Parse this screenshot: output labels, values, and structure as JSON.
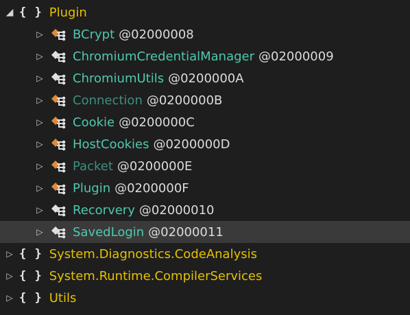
{
  "colors": {
    "background": "#1e1e1e",
    "namespace": "#e5c100",
    "class_name": "#4ec9b0",
    "class_name_dim": "#3f8f7f",
    "token": "#dcdcdc",
    "selected_row": "#3a3a3a",
    "icon_orange": "#e08a3c"
  },
  "tree": {
    "root": {
      "glyph_expanded": "◢",
      "brace": "{ }",
      "name": "Plugin"
    },
    "classes": [
      {
        "name": "BCrypt",
        "token": "@02000008"
      },
      {
        "name": "ChromiumCredentialManager",
        "token": "@02000009"
      },
      {
        "name": "ChromiumUtils",
        "token": "@0200000A"
      },
      {
        "name": "Connection",
        "token": "@0200000B"
      },
      {
        "name": "Cookie",
        "token": "@0200000C"
      },
      {
        "name": "HostCookies",
        "token": "@0200000D"
      },
      {
        "name": "Packet",
        "token": "@0200000E"
      },
      {
        "name": "Plugin",
        "token": "@0200000F"
      },
      {
        "name": "Recorvery",
        "token": "@02000010"
      },
      {
        "name": "SavedLogin",
        "token": "@02000011"
      }
    ],
    "namespaces": [
      {
        "brace": "{ }",
        "name": "System.Diagnostics.CodeAnalysis"
      },
      {
        "brace": "{ }",
        "name": "System.Runtime.CompilerServices"
      },
      {
        "brace": "{ }",
        "name": "Utils"
      }
    ],
    "glyph_collapsed": "▷",
    "class_icon": "class-icon"
  }
}
